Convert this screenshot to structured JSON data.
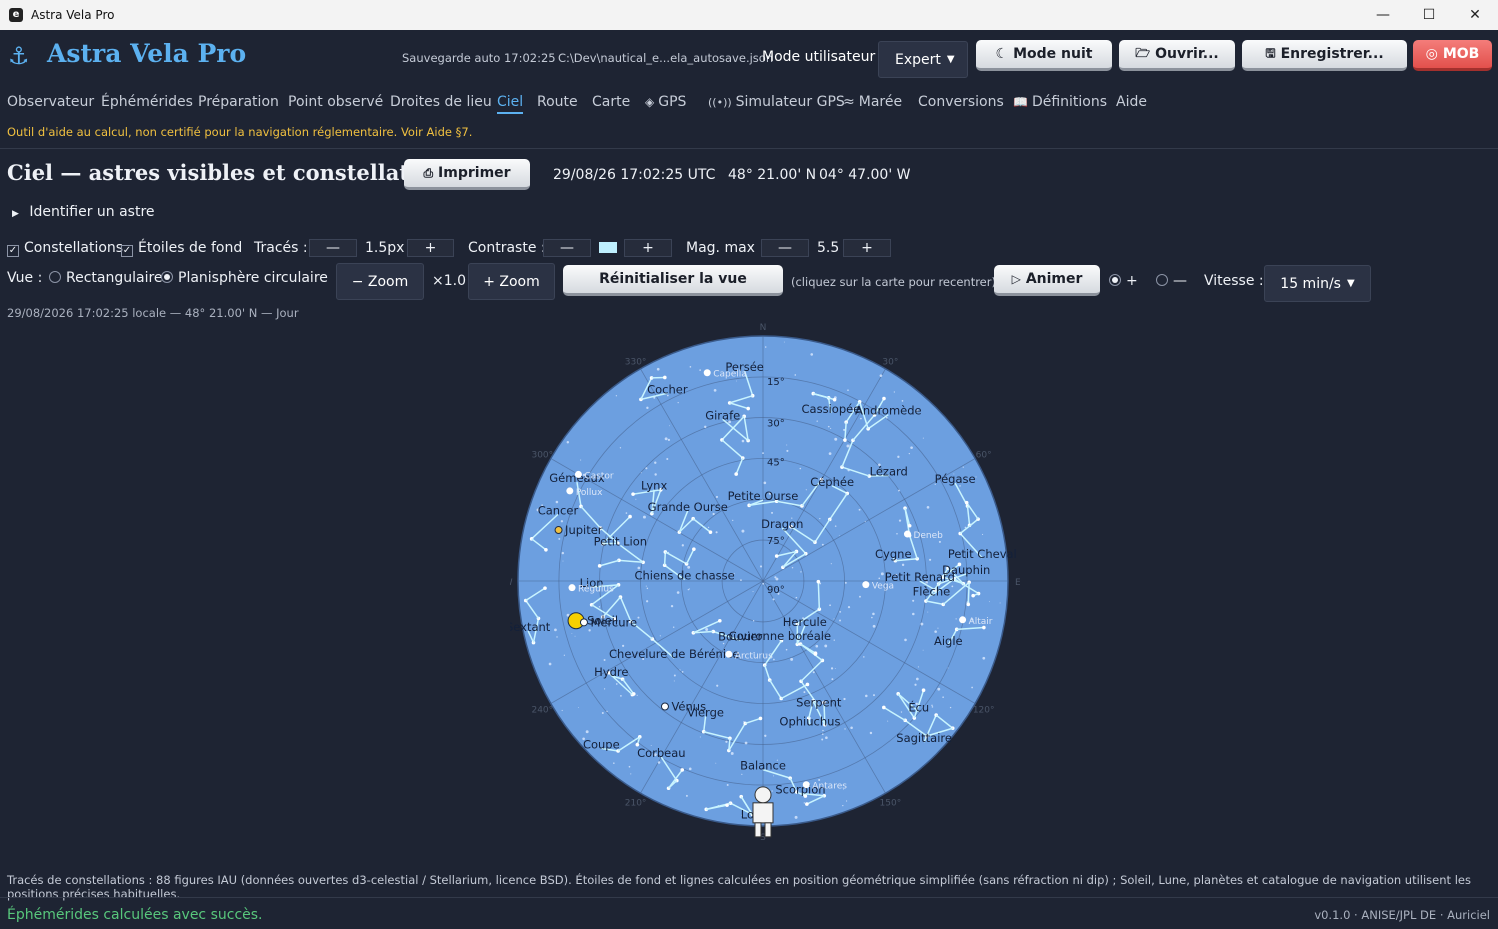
{
  "window": {
    "title": "Astra Vela Pro",
    "icon": "e"
  },
  "header": {
    "app_title": "Astra Vela Pro",
    "autosave": "Sauvegarde auto 17:02:25",
    "path": "C:\\Dev\\nautical_e...ela_autosave.json",
    "mode_label": "Mode utilisateur :",
    "mode_value": "Expert",
    "night_btn": "Mode nuit",
    "open_btn": "Ouvrir...",
    "save_btn": "Enregistrer...",
    "mob_btn": "MOB"
  },
  "tabs": [
    "Observateur",
    "Éphémérides",
    "Préparation",
    "Point observé",
    "Droites de lieu",
    "Ciel",
    "Route",
    "Carte",
    "GPS",
    "Simulateur GPS",
    "Marée",
    "Conversions",
    "Définitions",
    "Aide"
  ],
  "active_tab": "Ciel",
  "warning": "Outil d'aide au calcul, non certifié pour la navigation réglementaire. Voir Aide §7.",
  "page": {
    "title": "Ciel — astres visibles et constellations",
    "print_btn": "Imprimer",
    "datetime": "29/08/26 17:02:25 UTC",
    "lat": "48° 21.00' N",
    "lon": "04° 47.00' W",
    "identify": "Identifier un astre"
  },
  "controls": {
    "constellations": "Constellations",
    "background_stars": "Étoiles de fond",
    "traces_label": "Tracés :",
    "traces_value": "1.5px",
    "contrast_label": "Contraste :",
    "contrast_color": "#bff0ff",
    "magmax_label": "Mag. max :",
    "magmax_value": "5.5",
    "minus": "—",
    "plus": "+",
    "view_label": "Vue :",
    "view_rect": "Rectangulaire",
    "view_circ": "Planisphère circulaire",
    "zoom_minus": "− Zoom",
    "zoom_value": "×1.0",
    "zoom_plus": "+ Zoom",
    "reset_view": "Réinitialiser la vue",
    "recenter_hint": "(cliquez sur la carte pour recentrer)",
    "animate": "Animer",
    "radio_plus": "+",
    "radio_minus": "—",
    "speed_label": "Vitesse :",
    "speed_value": "15 min/s"
  },
  "subinfo": "29/08/2026  17:02:25 locale  —  48° 21.00' N  —  Jour",
  "sky": {
    "constellations": [
      {
        "name": "Persée",
        "r": 0.86,
        "az": 355
      },
      {
        "name": "Cocher",
        "r": 0.86,
        "az": 333
      },
      {
        "name": "Girafe",
        "r": 0.68,
        "az": 346
      },
      {
        "name": "Cassiopée",
        "r": 0.74,
        "az": 22
      },
      {
        "name": "Andromède",
        "r": 0.85,
        "az": 37
      },
      {
        "name": "Gémeaux",
        "r": 0.86,
        "az": 298
      },
      {
        "name": "Lynx",
        "r": 0.58,
        "az": 310
      },
      {
        "name": "Céphée",
        "r": 0.48,
        "az": 36
      },
      {
        "name": "Lézard",
        "r": 0.67,
        "az": 50
      },
      {
        "name": "Pégase",
        "r": 0.88,
        "az": 63
      },
      {
        "name": "Petite Ourse",
        "r": 0.33,
        "az": 0
      },
      {
        "name": "Cancer",
        "r": 0.88,
        "az": 288
      },
      {
        "name": "Grande Ourse",
        "r": 0.42,
        "az": 313
      },
      {
        "name": "Dragon",
        "r": 0.23,
        "az": 20
      },
      {
        "name": "Cygne",
        "r": 0.54,
        "az": 80
      },
      {
        "name": "Petit Lion",
        "r": 0.6,
        "az": 284
      },
      {
        "name": "Petit Cheval",
        "r": 0.9,
        "az": 84
      },
      {
        "name": "Dauphin",
        "r": 0.83,
        "az": 88
      },
      {
        "name": "Lion",
        "r": 0.7,
        "az": 268
      },
      {
        "name": "Chiens de chasse",
        "r": 0.32,
        "az": 271
      },
      {
        "name": "Petit Renard",
        "r": 0.64,
        "az": 90
      },
      {
        "name": "Flèche",
        "r": 0.69,
        "az": 95
      },
      {
        "name": "Hercule",
        "r": 0.25,
        "az": 137
      },
      {
        "name": "Sextant",
        "r": 0.98,
        "az": 258
      },
      {
        "name": "Bouvier",
        "r": 0.26,
        "az": 201
      },
      {
        "name": "Chevelure de Bérénice",
        "r": 0.48,
        "az": 229
      },
      {
        "name": "Couronne boréale",
        "r": 0.25,
        "az": 164
      },
      {
        "name": "Aigle",
        "r": 0.8,
        "az": 109
      },
      {
        "name": "Hydre",
        "r": 0.73,
        "az": 238
      },
      {
        "name": "Serpent",
        "r": 0.56,
        "az": 156
      },
      {
        "name": "Écu",
        "r": 0.83,
        "az": 130
      },
      {
        "name": "Ophiuchus",
        "r": 0.62,
        "az": 162
      },
      {
        "name": "Vierge",
        "r": 0.6,
        "az": 203
      },
      {
        "name": "Coupe",
        "r": 0.95,
        "az": 224
      },
      {
        "name": "Corbeau",
        "r": 0.83,
        "az": 210
      },
      {
        "name": "Sagittaire",
        "r": 0.93,
        "az": 135
      },
      {
        "name": "Balance",
        "r": 0.77,
        "az": 180
      },
      {
        "name": "Scorpion",
        "r": 0.88,
        "az": 170
      },
      {
        "name": "Loup",
        "r": 0.97,
        "az": 182
      }
    ],
    "named_stars": [
      {
        "name": "Capella",
        "r": 0.88,
        "az": 345
      },
      {
        "name": "Castor",
        "r": 0.87,
        "az": 300
      },
      {
        "name": "Pollux",
        "r": 0.87,
        "az": 295
      },
      {
        "name": "Deneb",
        "r": 0.62,
        "az": 72
      },
      {
        "name": "Vega",
        "r": 0.42,
        "az": 92
      },
      {
        "name": "Altair",
        "r": 0.83,
        "az": 101
      },
      {
        "name": "Arcturus",
        "r": 0.33,
        "az": 205
      },
      {
        "name": "Antares",
        "r": 0.85,
        "az": 168
      },
      {
        "name": "Régulus",
        "r": 0.78,
        "az": 268
      }
    ],
    "bodies": [
      {
        "name": "Jupiter",
        "r": 0.86,
        "az": 284,
        "color": "#f0c040"
      },
      {
        "name": "Soleil",
        "r": 0.78,
        "az": 258,
        "color": "#f7d000"
      },
      {
        "name": "Mercure",
        "r": 0.75,
        "az": 257,
        "color": "#ffffff"
      },
      {
        "name": "Vénus",
        "r": 0.65,
        "az": 218,
        "color": "#ffffff"
      }
    ],
    "alt_labels": [
      "15°",
      "30°",
      "45°",
      "75°",
      "90°"
    ],
    "cardinals": {
      "n": "N",
      "e": "E",
      "s": "S",
      "w": "W"
    },
    "az_labels": [
      "30°",
      "60°",
      "120°",
      "150°",
      "210°",
      "240°",
      "300°",
      "330°"
    ]
  },
  "footer_note": "Tracés de constellations : 88 figures IAU (données ouvertes d3-celestial / Stellarium, licence BSD). Étoiles de fond et lignes calculées en position géométrique simplifiée (sans réfraction ni dip) ; Soleil, Lune, planètes et catalogue de navigation utilisent les positions précises habituelles.",
  "status": "Éphémérides calculées avec succès.",
  "version": "v0.1.0 · ANISE/JPL DE · Auriciel"
}
